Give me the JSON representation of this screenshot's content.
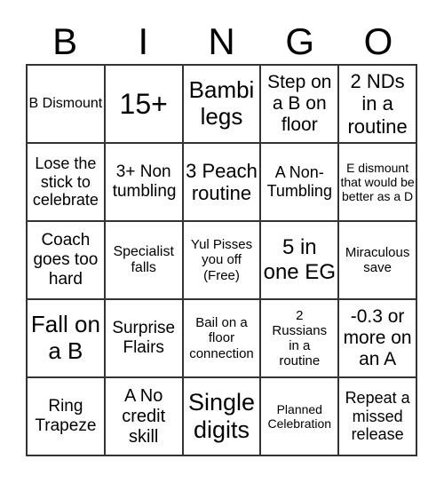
{
  "header": [
    "B",
    "I",
    "N",
    "G",
    "O"
  ],
  "cells": [
    [
      "B Dismount",
      "15+",
      "Bambi legs",
      "Step on a B on floor",
      "2 NDs in a routine"
    ],
    [
      "Lose the stick to celebrate",
      "3+ Non tumbling",
      "3 Peach routine",
      "A Non-Tumbling",
      "E dismount that would be better as a D"
    ],
    [
      "Coach goes too hard",
      "Specialist falls",
      "Yul Pisses you off (Free)",
      "5 in one EG",
      "Miraculous save"
    ],
    [
      "Fall on a B",
      "Surprise Flairs",
      "Bail on a floor connection",
      "2 Russians in a routine",
      "-0.3 or more on an A"
    ],
    [
      "Ring Trapeze",
      "A No credit skill",
      "Single digits",
      "Planned Celebration",
      "Repeat a missed release"
    ]
  ]
}
